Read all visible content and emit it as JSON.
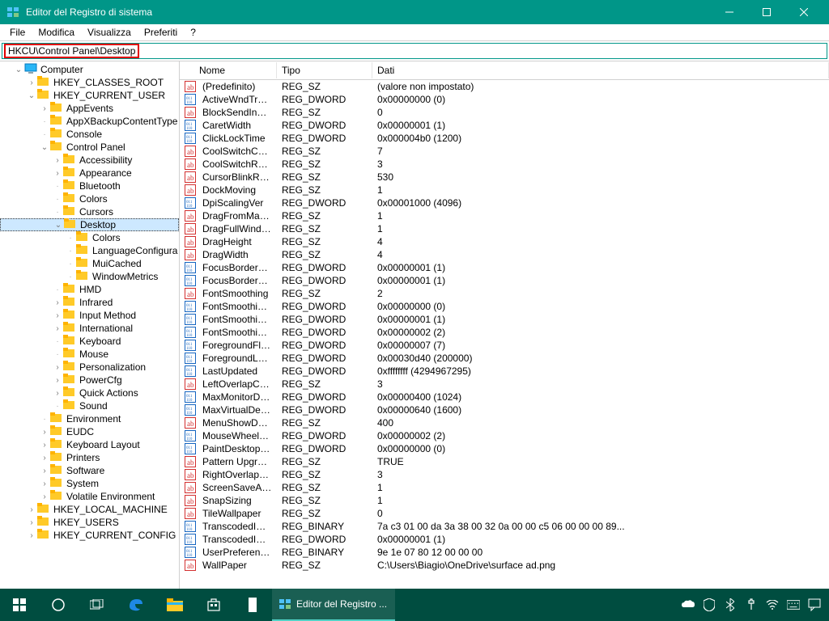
{
  "titlebar": {
    "title": "Editor del Registro di sistema"
  },
  "menubar": {
    "items": [
      "File",
      "Modifica",
      "Visualizza",
      "Preferiti",
      "?"
    ]
  },
  "addressbar": {
    "path": "HKCU\\Control Panel\\Desktop"
  },
  "tree": {
    "root": "Computer",
    "hives": [
      {
        "name": "HKEY_CLASSES_ROOT",
        "expanded": false,
        "selected": false
      },
      {
        "name": "HKEY_CURRENT_USER",
        "expanded": true,
        "selected": false,
        "children": [
          {
            "name": "AppEvents",
            "expandable": true
          },
          {
            "name": "AppXBackupContentType",
            "expandable": false
          },
          {
            "name": "Console",
            "expandable": false
          },
          {
            "name": "Control Panel",
            "expandable": true,
            "expanded": true,
            "children": [
              {
                "name": "Accessibility",
                "expandable": true
              },
              {
                "name": "Appearance",
                "expandable": true
              },
              {
                "name": "Bluetooth",
                "expandable": false
              },
              {
                "name": "Colors",
                "expandable": false
              },
              {
                "name": "Cursors",
                "expandable": false
              },
              {
                "name": "Desktop",
                "expandable": true,
                "expanded": true,
                "selected": true,
                "children": [
                  {
                    "name": "Colors"
                  },
                  {
                    "name": "LanguageConfigura"
                  },
                  {
                    "name": "MuiCached"
                  },
                  {
                    "name": "WindowMetrics"
                  }
                ]
              },
              {
                "name": "HMD",
                "expandable": false
              },
              {
                "name": "Infrared",
                "expandable": true
              },
              {
                "name": "Input Method",
                "expandable": true
              },
              {
                "name": "International",
                "expandable": true
              },
              {
                "name": "Keyboard",
                "expandable": false
              },
              {
                "name": "Mouse",
                "expandable": false
              },
              {
                "name": "Personalization",
                "expandable": true
              },
              {
                "name": "PowerCfg",
                "expandable": true
              },
              {
                "name": "Quick Actions",
                "expandable": true
              },
              {
                "name": "Sound",
                "expandable": false
              }
            ]
          },
          {
            "name": "Environment",
            "expandable": false
          },
          {
            "name": "EUDC",
            "expandable": true
          },
          {
            "name": "Keyboard Layout",
            "expandable": true
          },
          {
            "name": "Printers",
            "expandable": true
          },
          {
            "name": "Software",
            "expandable": true
          },
          {
            "name": "System",
            "expandable": true
          },
          {
            "name": "Volatile Environment",
            "expandable": true
          }
        ]
      },
      {
        "name": "HKEY_LOCAL_MACHINE",
        "expanded": false
      },
      {
        "name": "HKEY_USERS",
        "expanded": false
      },
      {
        "name": "HKEY_CURRENT_CONFIG",
        "expanded": false
      }
    ]
  },
  "columns": {
    "name": "Nome",
    "type": "Tipo",
    "data": "Dati"
  },
  "values": [
    {
      "name": "(Predefinito)",
      "type": "REG_SZ",
      "data": "(valore non impostato)"
    },
    {
      "name": "ActiveWndTrack...",
      "type": "REG_DWORD",
      "data": "0x00000000 (0)"
    },
    {
      "name": "BlockSendInputR...",
      "type": "REG_SZ",
      "data": "0"
    },
    {
      "name": "CaretWidth",
      "type": "REG_DWORD",
      "data": "0x00000001 (1)"
    },
    {
      "name": "ClickLockTime",
      "type": "REG_DWORD",
      "data": "0x000004b0 (1200)"
    },
    {
      "name": "CoolSwitchColumns",
      "type": "REG_SZ",
      "data": "7"
    },
    {
      "name": "CoolSwitchRows",
      "type": "REG_SZ",
      "data": "3"
    },
    {
      "name": "CursorBlinkRate",
      "type": "REG_SZ",
      "data": "530"
    },
    {
      "name": "DockMoving",
      "type": "REG_SZ",
      "data": "1"
    },
    {
      "name": "DpiScalingVer",
      "type": "REG_DWORD",
      "data": "0x00001000 (4096)"
    },
    {
      "name": "DragFromMaximize",
      "type": "REG_SZ",
      "data": "1"
    },
    {
      "name": "DragFullWindows",
      "type": "REG_SZ",
      "data": "1"
    },
    {
      "name": "DragHeight",
      "type": "REG_SZ",
      "data": "4"
    },
    {
      "name": "DragWidth",
      "type": "REG_SZ",
      "data": "4"
    },
    {
      "name": "FocusBorderHeight",
      "type": "REG_DWORD",
      "data": "0x00000001 (1)"
    },
    {
      "name": "FocusBorderWidth",
      "type": "REG_DWORD",
      "data": "0x00000001 (1)"
    },
    {
      "name": "FontSmoothing",
      "type": "REG_SZ",
      "data": "2"
    },
    {
      "name": "FontSmoothingGa...",
      "type": "REG_DWORD",
      "data": "0x00000000 (0)"
    },
    {
      "name": "FontSmoothingOri...",
      "type": "REG_DWORD",
      "data": "0x00000001 (1)"
    },
    {
      "name": "FontSmoothingType",
      "type": "REG_DWORD",
      "data": "0x00000002 (2)"
    },
    {
      "name": "ForegroundFlashC...",
      "type": "REG_DWORD",
      "data": "0x00000007 (7)"
    },
    {
      "name": "ForegroundLockTi...",
      "type": "REG_DWORD",
      "data": "0x00030d40 (200000)"
    },
    {
      "name": "LastUpdated",
      "type": "REG_DWORD",
      "data": "0xffffffff (4294967295)"
    },
    {
      "name": "LeftOverlapChars",
      "type": "REG_SZ",
      "data": "3"
    },
    {
      "name": "MaxMonitorDimen...",
      "type": "REG_DWORD",
      "data": "0x00000400 (1024)"
    },
    {
      "name": "MaxVirtualDeskto...",
      "type": "REG_DWORD",
      "data": "0x00000640 (1600)"
    },
    {
      "name": "MenuShowDelay",
      "type": "REG_SZ",
      "data": "400"
    },
    {
      "name": "MouseWheelRout...",
      "type": "REG_DWORD",
      "data": "0x00000002 (2)"
    },
    {
      "name": "PaintDesktopVersi...",
      "type": "REG_DWORD",
      "data": "0x00000000 (0)"
    },
    {
      "name": "Pattern Upgrade",
      "type": "REG_SZ",
      "data": "TRUE"
    },
    {
      "name": "RightOverlapChars",
      "type": "REG_SZ",
      "data": "3"
    },
    {
      "name": "ScreenSaveActive",
      "type": "REG_SZ",
      "data": "1"
    },
    {
      "name": "SnapSizing",
      "type": "REG_SZ",
      "data": "1"
    },
    {
      "name": "TileWallpaper",
      "type": "REG_SZ",
      "data": "0"
    },
    {
      "name": "TranscodedImage...",
      "type": "REG_BINARY",
      "data": "7a c3 01 00 da 3a 38 00 32 0a 00 00 c5 06 00 00 00 89..."
    },
    {
      "name": "TranscodedImage...",
      "type": "REG_DWORD",
      "data": "0x00000001 (1)"
    },
    {
      "name": "UserPreferences...",
      "type": "REG_BINARY",
      "data": "9e 1e 07 80 12 00 00 00"
    },
    {
      "name": "WallPaper",
      "type": "REG_SZ",
      "data": "C:\\Users\\Biagio\\OneDrive\\surface ad.png"
    }
  ],
  "taskbar": {
    "task_label": "Editor del Registro ..."
  }
}
